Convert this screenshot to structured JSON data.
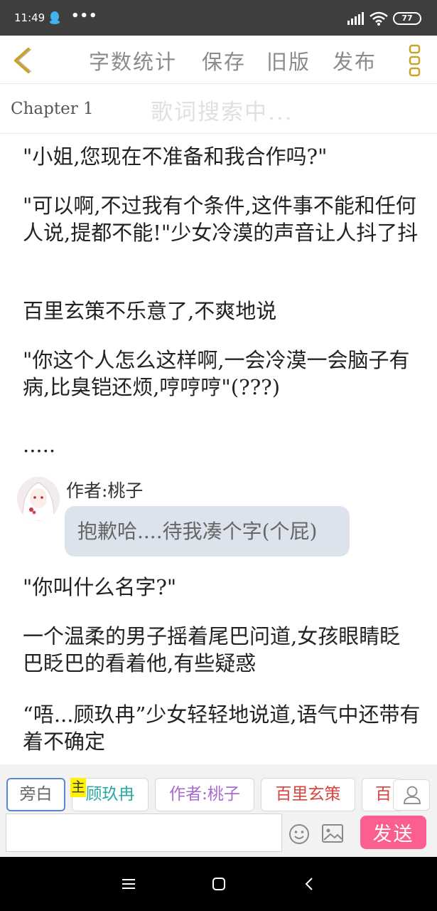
{
  "status_bar": {
    "time": "11:49",
    "dots": "•••",
    "battery": "77",
    "icons": [
      "qq-icon",
      "signal-icon",
      "wifi-icon",
      "battery-icon"
    ]
  },
  "toolbar": {
    "word_count": "字数统计",
    "save": "保存",
    "old_version": "旧版",
    "publish": "发布",
    "icons": [
      "back-arrow-icon",
      "more-vertical-icon"
    ],
    "accent_color": "#c9a227"
  },
  "chapter": {
    "title": "Chapter  1",
    "lyrics_hint": "歌词搜索中..."
  },
  "content": {
    "paragraphs": [
      "\"小姐,您现在不准备和我合作吗?\"",
      "\"可以啊,不过我有个条件,这件事不能和任何人说,提都不能!\"少女冷漠的声音让人抖了抖",
      "百里玄策不乐意了,不爽地说",
      "\"你这个人怎么这样啊,一会冷漠一会脑子有病,比臭铠还烦,哼哼哼\"(???)",
      "....."
    ],
    "author_message": {
      "name": "作者:桃子",
      "text": "抱歉哈....待我凑个字(个屁)"
    },
    "paragraphs_after": [
      "\"你叫什么名字?\"",
      "一个温柔的男子摇着尾巴问道,女孩眼睛眨巴眨巴的看着他,有些疑惑",
      "“唔...顾玖冉”少女轻轻地说道,语气中还带有着不确定"
    ]
  },
  "characters": {
    "chips": [
      {
        "label": "旁白",
        "color": "#666666"
      },
      {
        "label": "顾玖冉",
        "color": "#2aa7a0"
      },
      {
        "label": "作者:桃子",
        "color": "#a86bd1"
      },
      {
        "label": "百里玄策",
        "color": "#d9443f"
      },
      {
        "label": "百",
        "color": "#d9443f"
      }
    ],
    "main_badge": "主"
  },
  "input": {
    "value": "",
    "placeholder": "",
    "send_label": "发送",
    "send_color": "#fb5f8f"
  }
}
